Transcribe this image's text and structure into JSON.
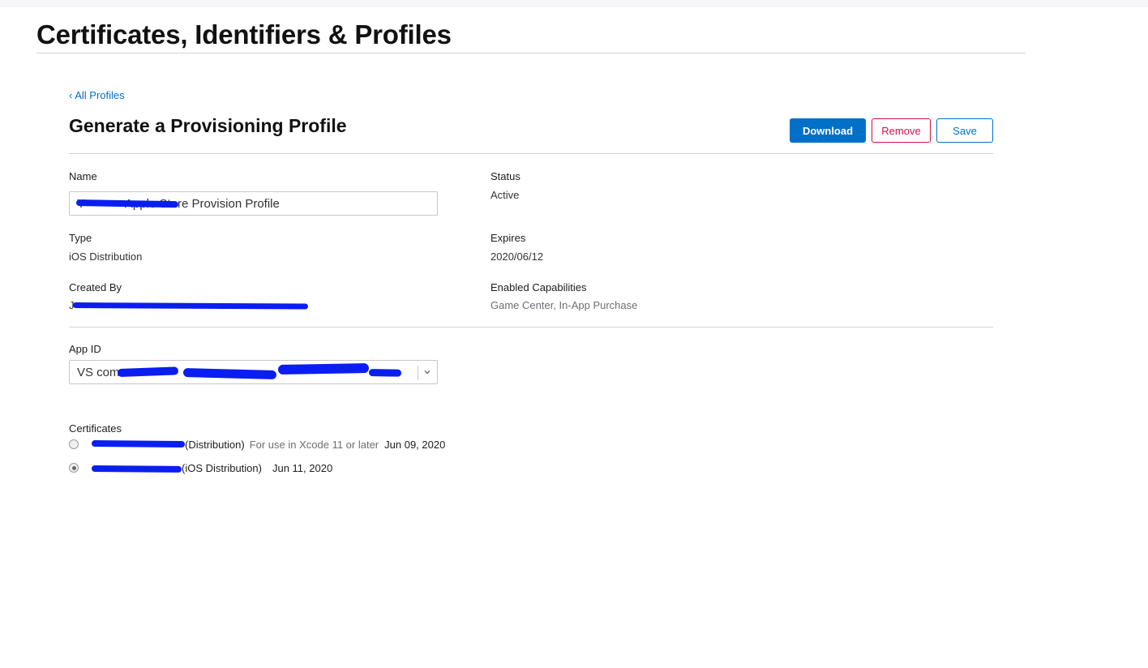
{
  "header": {
    "title": "Certificates, Identifiers & Profiles"
  },
  "breadcrumb": {
    "back_label": "‹ All Profiles"
  },
  "profile": {
    "section_title": "Generate a Provisioning Profile",
    "actions": {
      "download": "Download",
      "remove": "Remove",
      "save": "Save"
    },
    "name": {
      "label": "Name",
      "value": "Y            Apple Store Provision Profile"
    },
    "status": {
      "label": "Status",
      "value": "Active"
    },
    "type": {
      "label": "Type",
      "value": "iOS Distribution"
    },
    "expires": {
      "label": "Expires",
      "value": "2020/06/12"
    },
    "created_by": {
      "label": "Created By",
      "value": "J"
    },
    "capabilities": {
      "label": "Enabled Capabilities",
      "value": "Game Center, In-App Purchase"
    },
    "app_id": {
      "label": "App ID",
      "selected": "VS com"
    },
    "certificates": {
      "label": "Certificates",
      "items": [
        {
          "name": "(Distribution)",
          "note": "For use in Xcode 11 or later",
          "date": "Jun 09, 2020",
          "selected": false
        },
        {
          "name": "(iOS Distribution)",
          "note": "",
          "date": "Jun 11, 2020",
          "selected": true
        }
      ]
    }
  },
  "colors": {
    "accent": "#0070c9",
    "danger": "#d30f4a",
    "redaction": "#0a1ef0"
  },
  "icons": {
    "select": "chevron-down-icon"
  }
}
